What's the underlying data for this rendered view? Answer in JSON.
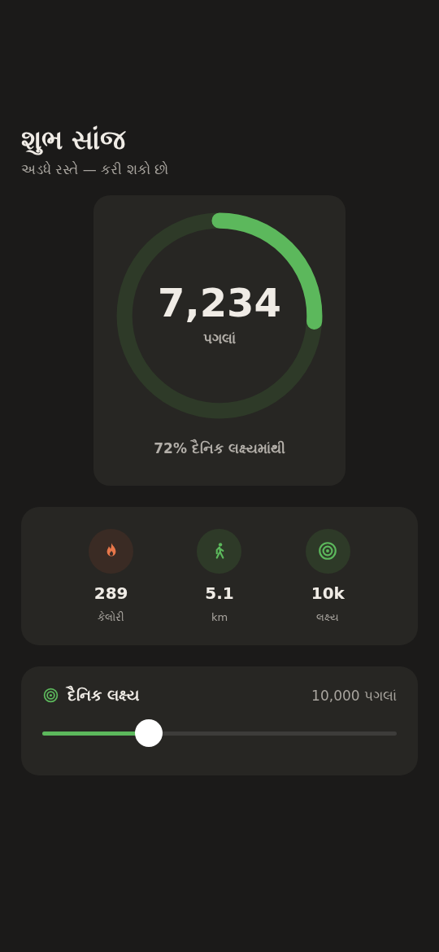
{
  "header": {
    "title": "શુભ સાંજ",
    "subtitle": "અડધે રસ્તે — કરી શકો છો"
  },
  "ring_card": {
    "value": "7,234",
    "unit": "પગલાં",
    "caption": "72% દૈનિક લક્ષ્યમાંથી"
  },
  "stats": [
    {
      "kind": "flame",
      "value": "289",
      "label": "કેલોરી",
      "color": "#e8774a"
    },
    {
      "kind": "walk",
      "value": "5.1",
      "label": "km",
      "color": "#5cb85c"
    },
    {
      "kind": "target",
      "value": "10k",
      "label": "લક્ષ્ય",
      "color": "#5cb85c"
    }
  ],
  "goal": {
    "title": "દૈનિક લક્ષ્ય",
    "reading": "10,000 પગલાં",
    "level": 0.3
  }
}
